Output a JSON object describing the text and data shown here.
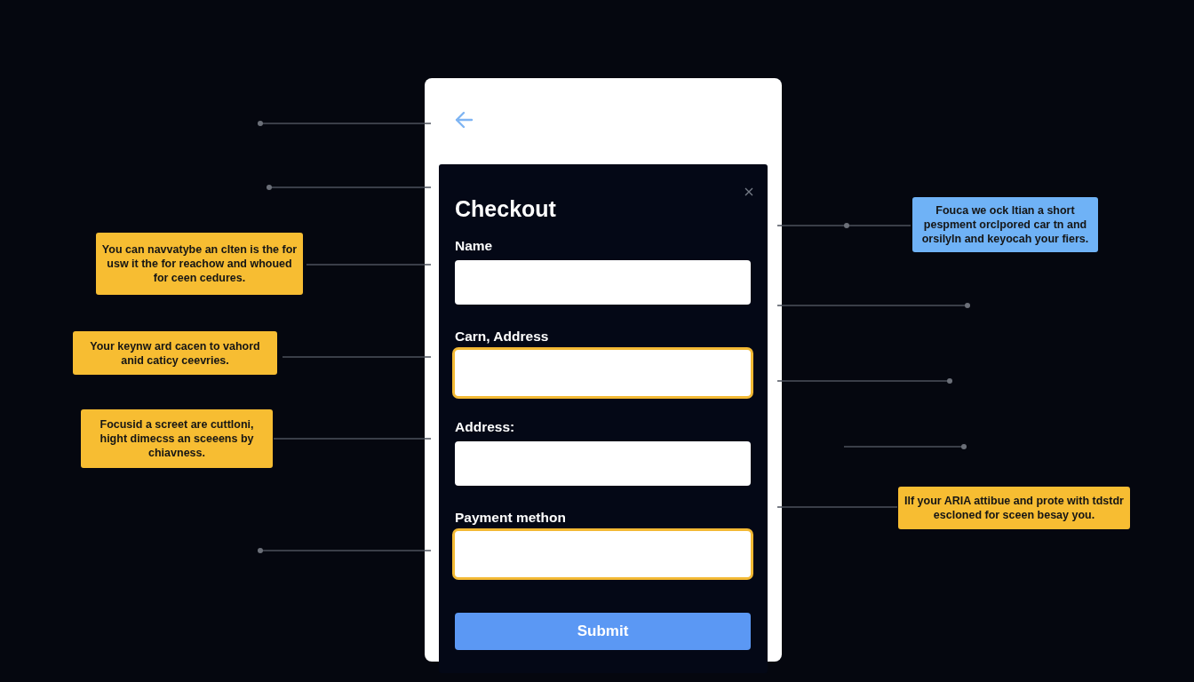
{
  "form": {
    "title": "Checkout",
    "fields": [
      {
        "label": "Name",
        "focused": false
      },
      {
        "label": "Carn, Address",
        "focused": true
      },
      {
        "label": "Address:",
        "focused": false
      },
      {
        "label": "Payment methon",
        "focused": true
      }
    ],
    "submit": "Submit"
  },
  "callouts": [
    {
      "text": "You can navvatybe an clten is the for usw it the for reachow and whoued for ceen cedures.",
      "color": "#f7bd32"
    },
    {
      "text": "Your keynw ard cacen to vahord anid caticy ceevries.",
      "color": "#f7bd32"
    },
    {
      "text": "Focusid a screet are cuttloni, hight dimecss an sceeens by chiavness.",
      "color": "#f7bd32"
    },
    {
      "text": "Fouca we ock ltian a short pespment orclpored car tn and orsilyln and keyocah your fiers.",
      "color": "#6fb2f6"
    },
    {
      "text": "Ilf your ARIA attibue and prote with tdstdr escloned for sceen besay you.",
      "color": "#f7bd32"
    }
  ]
}
